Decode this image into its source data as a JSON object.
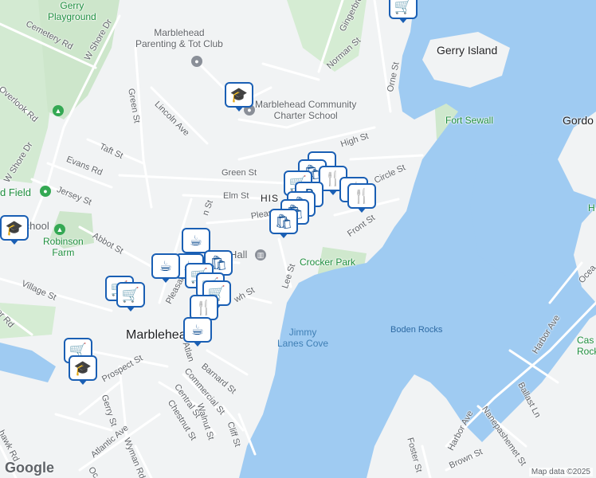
{
  "map": {
    "labels": {
      "gerry_playground": "Gerry\nPlayground",
      "parenting_club": "Marblehead\nParenting & Tot Club",
      "community_school": "Marblehead Community\nCharter School",
      "fort_sewall": "Fort Sewall",
      "gerry_island": "Gerry Island",
      "gordon": "Gordo",
      "crocker_park": "Crocker Park",
      "jimmy_lanes_cove": "Jimmy\nLanes Cove",
      "boden_rocks": "Boden Rocks",
      "robinson_farm": "Robinson\nFarm",
      "marblehead": "Marblehead",
      "historic": "HIS",
      "hall": "Hall",
      "school_left": "School",
      "field_left": "d Field",
      "castle_rock": "Cas\nRock",
      "h_right": "H"
    },
    "streets": {
      "cemetery_rd": "Cemetery Rd",
      "w_shore_dr_top": "W Shore Dr",
      "w_shore_dr_left": "W Shore Dr",
      "overlook_rd": "Overlook Rd",
      "green_st_v": "Green St",
      "lincoln_ave": "Lincoln Ave",
      "taft_st": "Taft St",
      "evans_rd": "Evans Rd",
      "jersey_st": "Jersey St",
      "abbot_st": "Abbot St",
      "village_st": "Village St",
      "ler_rd": "ler Rd",
      "green_st_h": "Green St",
      "elm_st": "Elm St",
      "pleasant_top": "Pleas",
      "pleasant_st": "Pleasant St",
      "high_st": "High St",
      "norman_st": "Norman St",
      "gingerbread": "Gingerbre",
      "orne_st": "Orne St",
      "circle_st": "Circle St",
      "front_st": "Front St",
      "lee_st": "Lee St",
      "wh_st": "wh St",
      "prospect_st": "Prospect St",
      "gerry_st": "Gerry St",
      "atlantic_ave_v": "Atlan",
      "barnard_st": "Barnard St",
      "commercial_st": "Commercial St",
      "central_st": "Central St",
      "chestnut_st": "Chestnut St",
      "walnut_st": "Walnut St",
      "cliff_st": "Cliff St",
      "atlantic_ave": "Atlantic Ave",
      "wyman_rd": "Wyman Rd",
      "hawk_rd": "hawk Rd",
      "harbor_ave_top": "Harbor Ave",
      "harbor_ave_bottom": "Harbor Ave",
      "ballast_ln": "Ballast Ln",
      "nanepashemet_st": "Nanepashemet St",
      "foster_st": "Foster St",
      "brown_st": "Brown St",
      "ocea": "Ocea",
      "oc": "Oc",
      "ton_st": "n St"
    },
    "pins": [
      {
        "icon": "cart"
      },
      {
        "icon": "school"
      },
      {
        "icon": "shopping-bag"
      },
      {
        "icon": "restaurant"
      },
      {
        "icon": "restaurant"
      },
      {
        "icon": "restaurant"
      },
      {
        "icon": "coffee"
      },
      {
        "icon": "coffee"
      },
      {
        "icon": "coffee"
      },
      {
        "icon": "cart"
      },
      {
        "icon": "cart"
      },
      {
        "icon": "cart"
      },
      {
        "icon": "cart"
      },
      {
        "icon": "school"
      },
      {
        "icon": "school"
      },
      {
        "icon": "shopping-bag"
      },
      {
        "icon": "restaurant"
      }
    ],
    "attribution": "Map data ©2025",
    "logo": "Google",
    "colors": {
      "water": "#9fcbf2",
      "park": "#c7e6c5",
      "land": "#f1f3f4",
      "road": "#ffffff",
      "pin_border": "#1a5fb4"
    }
  }
}
